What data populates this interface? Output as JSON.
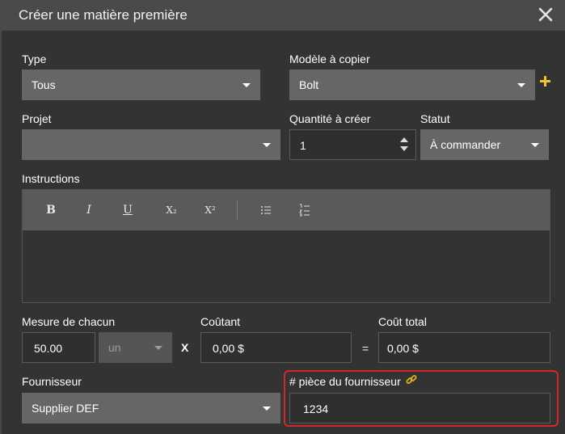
{
  "dialog": {
    "title": "Créer une matière première",
    "close_icon": "close-icon"
  },
  "fields": {
    "type": {
      "label": "Type",
      "value": "Tous"
    },
    "model": {
      "label": "Modèle à copier",
      "value": "Bolt"
    },
    "project": {
      "label": "Projet",
      "value": ""
    },
    "quantity": {
      "label": "Quantité à créer",
      "value": "1"
    },
    "status": {
      "label": "Statut",
      "value": "À commander"
    },
    "instructions": {
      "label": "Instructions",
      "toolbar": {
        "bold": "B",
        "italic": "I",
        "underline": "U",
        "subscript": "X₂",
        "superscript": "X²"
      },
      "content": ""
    },
    "measure": {
      "label": "Mesure de chacun",
      "value": "50.00",
      "unit": "un"
    },
    "times_symbol": "X",
    "cost": {
      "label": "Coûtant",
      "value": "0,00 $"
    },
    "equals_symbol": "=",
    "total": {
      "label": "Coût total",
      "value": "0,00 $"
    },
    "supplier": {
      "label": "Fournisseur",
      "value": "Supplier DEF"
    },
    "supplier_part": {
      "label": "# pièce du fournisseur",
      "value": "1234"
    }
  },
  "colors": {
    "title_bar": "#4a4a4a",
    "background": "#333333",
    "select_bg": "#666666",
    "accent_plus": "#f2c230",
    "highlight_border": "#d6262b",
    "link_icon": "#e0b020"
  }
}
